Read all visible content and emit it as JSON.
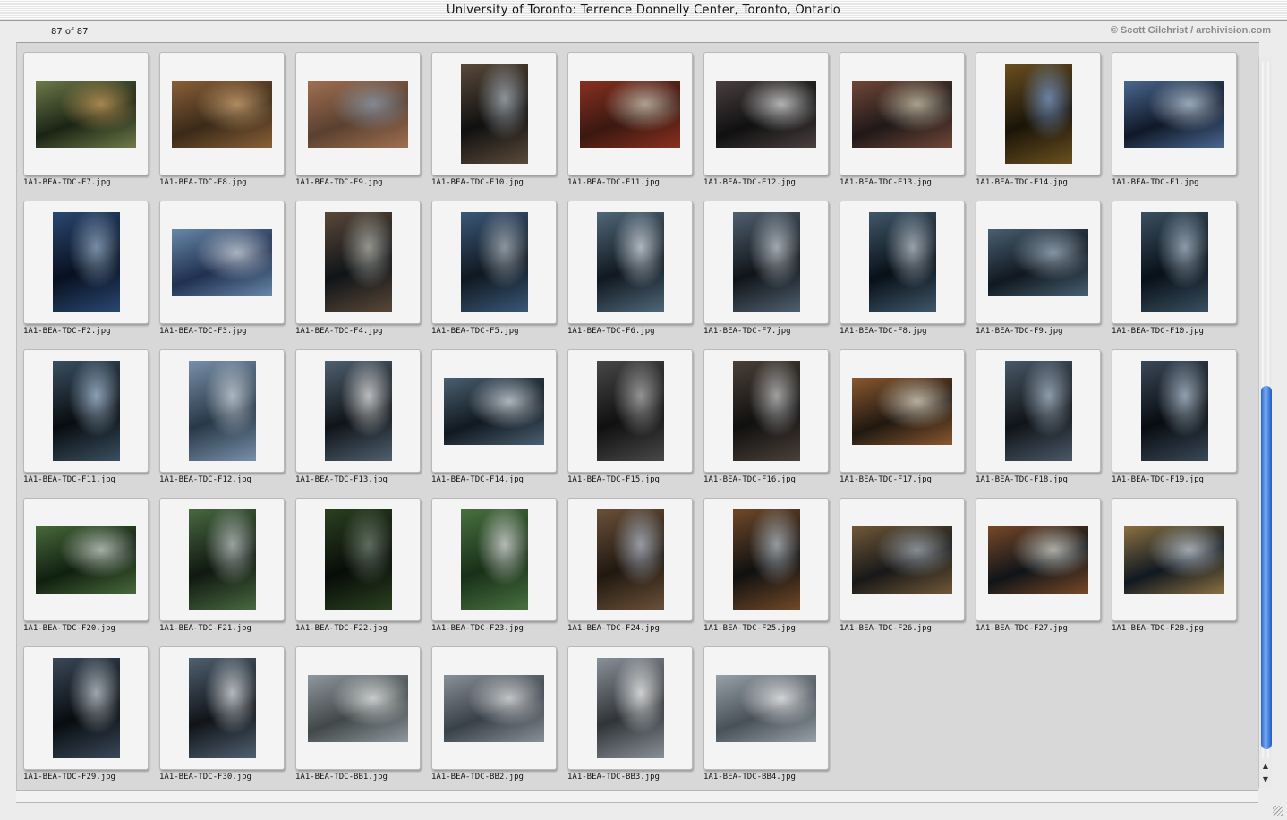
{
  "window": {
    "title": "University of Toronto: Terrence Donnelly Center, Toronto, Ontario"
  },
  "header": {
    "counter": "87 of 87",
    "credit": "© Scott Gilchrist / archivision.com"
  },
  "scrollbar": {
    "thumb_start": 0.465,
    "thumb_end": 0.985,
    "up_arrow": "▲",
    "down_arrow": "▼"
  },
  "thumbnails": [
    {
      "filename": "1A1-BEA-TDC-E7.jpg",
      "orientation": "landscape",
      "colors": [
        "#1a2414",
        "#6f7a4a",
        "#c49a5a"
      ]
    },
    {
      "filename": "1A1-BEA-TDC-E8.jpg",
      "orientation": "landscape",
      "colors": [
        "#3a2a18",
        "#8a6038",
        "#c8a070"
      ]
    },
    {
      "filename": "1A1-BEA-TDC-E9.jpg",
      "orientation": "landscape",
      "colors": [
        "#5a4030",
        "#a07050",
        "#8a98a8"
      ]
    },
    {
      "filename": "1A1-BEA-TDC-E10.jpg",
      "orientation": "portrait",
      "colors": [
        "#101010",
        "#5a4a3a",
        "#a8b0b8"
      ]
    },
    {
      "filename": "1A1-BEA-TDC-E11.jpg",
      "orientation": "landscape",
      "colors": [
        "#3a1810",
        "#8a3020",
        "#c8c0b0"
      ]
    },
    {
      "filename": "1A1-BEA-TDC-E12.jpg",
      "orientation": "landscape",
      "colors": [
        "#101010",
        "#4a4040",
        "#d8d8d8"
      ]
    },
    {
      "filename": "1A1-BEA-TDC-E13.jpg",
      "orientation": "landscape",
      "colors": [
        "#201818",
        "#704838",
        "#c8c0a8"
      ]
    },
    {
      "filename": "1A1-BEA-TDC-E14.jpg",
      "orientation": "portrait",
      "colors": [
        "#1a1408",
        "#6a5020",
        "#7898c8"
      ]
    },
    {
      "filename": "1A1-BEA-TDC-F1.jpg",
      "orientation": "landscape",
      "colors": [
        "#101828",
        "#4a6890",
        "#b8c8d8"
      ]
    },
    {
      "filename": "1A1-BEA-TDC-F2.jpg",
      "orientation": "portrait",
      "colors": [
        "#081020",
        "#2a4870",
        "#90a8c0"
      ]
    },
    {
      "filename": "1A1-BEA-TDC-F3.jpg",
      "orientation": "landscape",
      "colors": [
        "#203050",
        "#6888a8",
        "#c8d0d8"
      ]
    },
    {
      "filename": "1A1-BEA-TDC-F4.jpg",
      "orientation": "portrait",
      "colors": [
        "#101418",
        "#5a4838",
        "#b0b0a8"
      ]
    },
    {
      "filename": "1A1-BEA-TDC-F5.jpg",
      "orientation": "portrait",
      "colors": [
        "#101820",
        "#3a5878",
        "#a8b0b8"
      ]
    },
    {
      "filename": "1A1-BEA-TDC-F6.jpg",
      "orientation": "portrait",
      "colors": [
        "#101820",
        "#506878",
        "#d0d8e0"
      ]
    },
    {
      "filename": "1A1-BEA-TDC-F7.jpg",
      "orientation": "portrait",
      "colors": [
        "#101418",
        "#506070",
        "#c0c8d0"
      ]
    },
    {
      "filename": "1A1-BEA-TDC-F8.jpg",
      "orientation": "portrait",
      "colors": [
        "#081018",
        "#40586a",
        "#b8c0c8"
      ]
    },
    {
      "filename": "1A1-BEA-TDC-F9.jpg",
      "orientation": "landscape",
      "colors": [
        "#101820",
        "#486070",
        "#a0b0c0"
      ]
    },
    {
      "filename": "1A1-BEA-TDC-F10.jpg",
      "orientation": "portrait",
      "colors": [
        "#081018",
        "#3a5060",
        "#a8b8c8"
      ]
    },
    {
      "filename": "1A1-BEA-TDC-F11.jpg",
      "orientation": "portrait",
      "colors": [
        "#080c10",
        "#3a5060",
        "#a8c0d8"
      ]
    },
    {
      "filename": "1A1-BEA-TDC-F12.jpg",
      "orientation": "portrait",
      "colors": [
        "#283848",
        "#7890a8",
        "#c8d0d8"
      ]
    },
    {
      "filename": "1A1-BEA-TDC-F13.jpg",
      "orientation": "portrait",
      "colors": [
        "#101418",
        "#506070",
        "#e0e0e0"
      ]
    },
    {
      "filename": "1A1-BEA-TDC-F14.jpg",
      "orientation": "landscape",
      "colors": [
        "#101820",
        "#4a6070",
        "#d0d8e0"
      ]
    },
    {
      "filename": "1A1-BEA-TDC-F15.jpg",
      "orientation": "portrait",
      "colors": [
        "#101010",
        "#484848",
        "#b0b0b0"
      ]
    },
    {
      "filename": "1A1-BEA-TDC-F16.jpg",
      "orientation": "portrait",
      "colors": [
        "#101010",
        "#4a4038",
        "#c0c0c0"
      ]
    },
    {
      "filename": "1A1-BEA-TDC-F17.jpg",
      "orientation": "landscape",
      "colors": [
        "#201810",
        "#8a5830",
        "#d8d0c0"
      ]
    },
    {
      "filename": "1A1-BEA-TDC-F18.jpg",
      "orientation": "portrait",
      "colors": [
        "#101418",
        "#4a5868",
        "#a8b8c8"
      ]
    },
    {
      "filename": "1A1-BEA-TDC-F19.jpg",
      "orientation": "portrait",
      "colors": [
        "#080c10",
        "#3a4858",
        "#b0c0d0"
      ]
    },
    {
      "filename": "1A1-BEA-TDC-F20.jpg",
      "orientation": "landscape",
      "colors": [
        "#102010",
        "#48683a",
        "#c8d0c8"
      ]
    },
    {
      "filename": "1A1-BEA-TDC-F21.jpg",
      "orientation": "portrait",
      "colors": [
        "#101810",
        "#486840",
        "#b8c0c0"
      ]
    },
    {
      "filename": "1A1-BEA-TDC-F22.jpg",
      "orientation": "portrait",
      "colors": [
        "#080c08",
        "#2a4020",
        "#708070"
      ]
    },
    {
      "filename": "1A1-BEA-TDC-F23.jpg",
      "orientation": "portrait",
      "colors": [
        "#183018",
        "#487040",
        "#d8d8d8"
      ]
    },
    {
      "filename": "1A1-BEA-TDC-F24.jpg",
      "orientation": "portrait",
      "colors": [
        "#201810",
        "#6a5038",
        "#b0b8c8"
      ]
    },
    {
      "filename": "1A1-BEA-TDC-F25.jpg",
      "orientation": "portrait",
      "colors": [
        "#101010",
        "#704828",
        "#b0b8c0"
      ]
    },
    {
      "filename": "1A1-BEA-TDC-F26.jpg",
      "orientation": "landscape",
      "colors": [
        "#181818",
        "#705838",
        "#a0a8b0"
      ]
    },
    {
      "filename": "1A1-BEA-TDC-F27.jpg",
      "orientation": "landscape",
      "colors": [
        "#101418",
        "#784828",
        "#d0d0c8"
      ]
    },
    {
      "filename": "1A1-BEA-TDC-F28.jpg",
      "orientation": "landscape",
      "colors": [
        "#101820",
        "#8a7040",
        "#c0c8d0"
      ]
    },
    {
      "filename": "1A1-BEA-TDC-F29.jpg",
      "orientation": "portrait",
      "colors": [
        "#080c10",
        "#3a4858",
        "#c0c8d0"
      ]
    },
    {
      "filename": "1A1-BEA-TDC-F30.jpg",
      "orientation": "portrait",
      "colors": [
        "#101418",
        "#506070",
        "#d8dce0"
      ]
    },
    {
      "filename": "1A1-BEA-TDC-BB1.jpg",
      "orientation": "landscape",
      "colors": [
        "#404848",
        "#9098a0",
        "#e8e8e8"
      ]
    },
    {
      "filename": "1A1-BEA-TDC-BB2.jpg",
      "orientation": "landscape",
      "colors": [
        "#384048",
        "#8a9098",
        "#e0e0e0"
      ]
    },
    {
      "filename": "1A1-BEA-TDC-BB3.jpg",
      "orientation": "portrait",
      "colors": [
        "#303438",
        "#8a9098",
        "#f0f0f0"
      ]
    },
    {
      "filename": "1A1-BEA-TDC-BB4.jpg",
      "orientation": "landscape",
      "colors": [
        "#485058",
        "#98a0a8",
        "#f0f0f0"
      ]
    }
  ]
}
